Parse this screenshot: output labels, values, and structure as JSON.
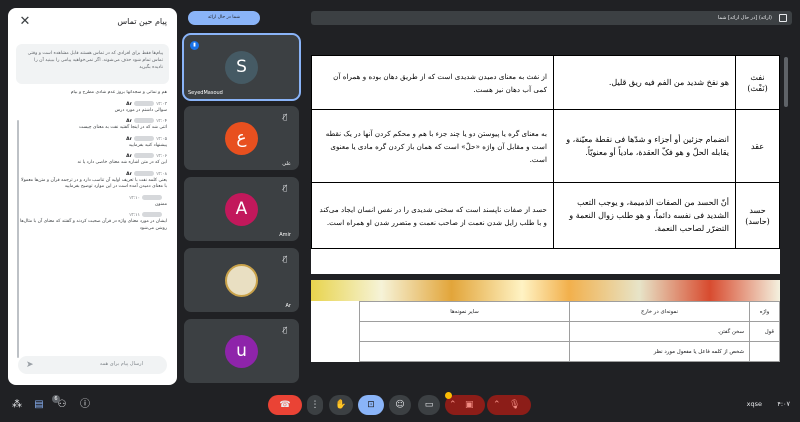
{
  "chat": {
    "title": "پیام حین تماس",
    "close_icon": "close-icon",
    "notice": "پیام‌ها فقط برای افرادی که در تماس هستند قابل مشاهده است و وقتی تماس تمام شود حذف می‌شوند. اگر نمی‌خواهید پیامی را ببینید آن را نادیده بگیرید",
    "messages": [
      {
        "name": "",
        "time": "",
        "text": "هم و نمانی و سجدا‌نها بروز عدم شادی مطرح و بیام"
      },
      {
        "name": "Ar",
        "time": "۱۳:۰۳",
        "text": "سوالی داشتم در مورد درس"
      },
      {
        "name": "Ar",
        "time": "۱۳:۰۴",
        "text": "اثنی شد که در اینجا گفتید نفت به معنای چیست"
      },
      {
        "name": "Ar",
        "time": "۱۳:۰۵",
        "text": "پیشنهاد کنید بفرمایید"
      },
      {
        "name": "Ar",
        "time": "۱۳:۰۶",
        "text": "این که در متن اشاره شد معنای خاصی دارد یا نه"
      },
      {
        "name": "Ar",
        "time": "۱۳:۰۸",
        "text": "یعنی کلمه نفت با تعریف اولیه آن تناسب دارد و در ترجمه قرآن و متن‌ها معمولا با معنای دمیدن آمده است در این موارد توضیح بفرمایید"
      },
      {
        "name": "",
        "time": "۱۳:۱۰",
        "text": "ممنون"
      },
      {
        "name": "",
        "time": "۱۳:۱۱",
        "text": "ایشان در مورد معنای واژه در قرآن صحبت کردند و گفتند که معنای آن با مثال‌ها روشن می‌شود"
      }
    ],
    "input_placeholder": "ارسال پیام برای همه",
    "send_icon": "send-icon"
  },
  "topbar": {
    "pill_label": "شما در حال ارائه",
    "presenting_text": "(ارائه) [در حال ارائه] شما",
    "present_icon": "present-screen-icon"
  },
  "participants": [
    {
      "letter": "S",
      "name": "SeyedMasoud",
      "color": "#455a64",
      "muted": false
    },
    {
      "letter": "ع",
      "name": "علی",
      "color": "#e8501f",
      "muted": true
    },
    {
      "letter": "A",
      "name": "Amir",
      "color": "#c2185b",
      "muted": true
    },
    {
      "letter": "",
      "name": "Ar",
      "color": "#e9dfc2",
      "muted": true
    },
    {
      "letter": "u",
      "name": "",
      "color": "#8e24aa",
      "muted": true
    }
  ],
  "slide1": {
    "rows": [
      {
        "word": "نفث (نَفْث)",
        "arabic": "هو نفخ شدید من الفم فیه ریق قلیل.",
        "persian": "از نفث به معنای دمیدن شدیدی است که از طریق دهان بوده و همراه آن کمی آب دهان نیز هست."
      },
      {
        "word": "عقد",
        "arabic": "انضمام جزئین أو أجزاء و شدّها فی نقطة معیّنة، و یقابله الحلّ و هو فکّ العقدة، مادیاً أو معنویّاً.",
        "persian": "به معنای گره یا پیوستن دو یا چند جزء با هم و محکم کردن آنها در یک نقطه است و مقابل آن واژه «حلّ» است که همان باز کردن گره مادی یا معنوی است."
      },
      {
        "word": "حسد (حاسد)",
        "arabic": "أنّ الحسد من الصفات الذمیمة، و یوجب التعب الشدید فی نفسه دائماً، و هو طلب زوال النعمة و التضرّر لصاحب النعمة.",
        "persian": "حسد از صفات ناپسند است که سختی شدیدی را در نفس انسان ایجاد می‌کند و با طلب زایل شدن نعمت از صاحب نعمت و متضرر شدن او همراه است."
      }
    ]
  },
  "slide2": {
    "headers": [
      "واژه",
      "نمونه‌ای در خارج",
      "سایر نمونه‌ها"
    ],
    "rows": [
      {
        "word": "قول",
        "example": "سخن گفتن.",
        "other": ""
      },
      {
        "word": "",
        "example": "شخص از کلمه فاعل یا مفعول مورد نظر",
        "other": ""
      }
    ]
  },
  "bottombar": {
    "time": "۴:۰۷",
    "meeting_code": "xqse",
    "participants_badge": "6"
  },
  "colors": {
    "background": "#202124",
    "tile": "#3c4043",
    "accent": "#8ab4f8",
    "leave": "#ea4335"
  }
}
